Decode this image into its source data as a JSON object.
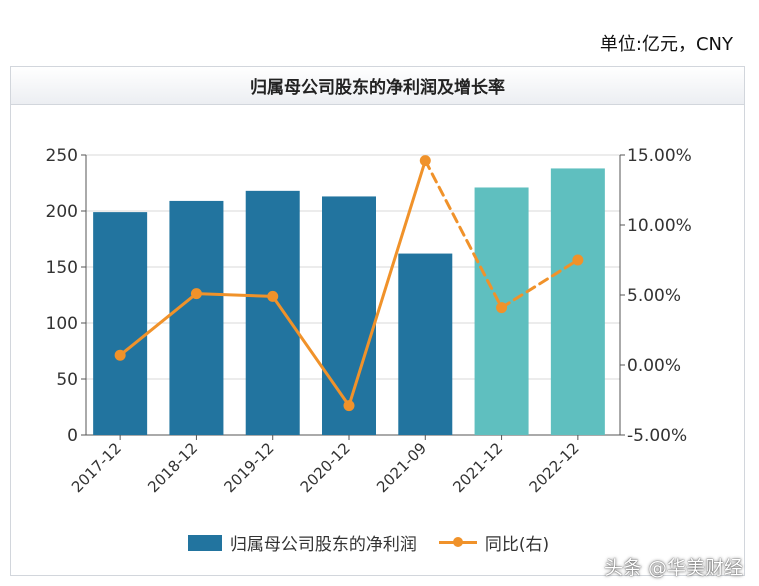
{
  "unit_label": "单位:亿元，CNY",
  "panel_title": "归属母公司股东的净利润及增长率",
  "colors": {
    "bar_actual": "#22749f",
    "bar_forecast": "#5fbfbf",
    "line": "#f0922a",
    "grid": "#d8d8d8",
    "axis": "#555555"
  },
  "chart_data": {
    "type": "bar",
    "title": "归属母公司股东的净利润及增长率",
    "categories": [
      "2017-12",
      "2018-12",
      "2019-12",
      "2020-12",
      "2021-09",
      "2021-12",
      "2022-12"
    ],
    "forecast_from_index": 5,
    "series": [
      {
        "name": "归属母公司股东的净利润",
        "axis": "left",
        "type": "bar",
        "values": [
          199,
          209,
          218,
          213,
          162,
          221,
          238
        ]
      },
      {
        "name": "同比(右)",
        "axis": "right",
        "type": "line",
        "unit": "%",
        "values": [
          0.7,
          5.1,
          4.9,
          -2.9,
          14.6,
          4.1,
          7.5
        ],
        "dashed_segments_from_index": 4
      }
    ],
    "y_left": {
      "lim": [
        0,
        250
      ],
      "ticks": [
        "0",
        "50",
        "100",
        "150",
        "200",
        "250"
      ]
    },
    "y_right": {
      "lim": [
        -5,
        15
      ],
      "ticks": [
        "-5.00%",
        "0.00%",
        "5.00%",
        "10.00%",
        "15.00%"
      ]
    },
    "grid": true,
    "legend_position": "bottom"
  },
  "watermark": "头条 @华美财经"
}
